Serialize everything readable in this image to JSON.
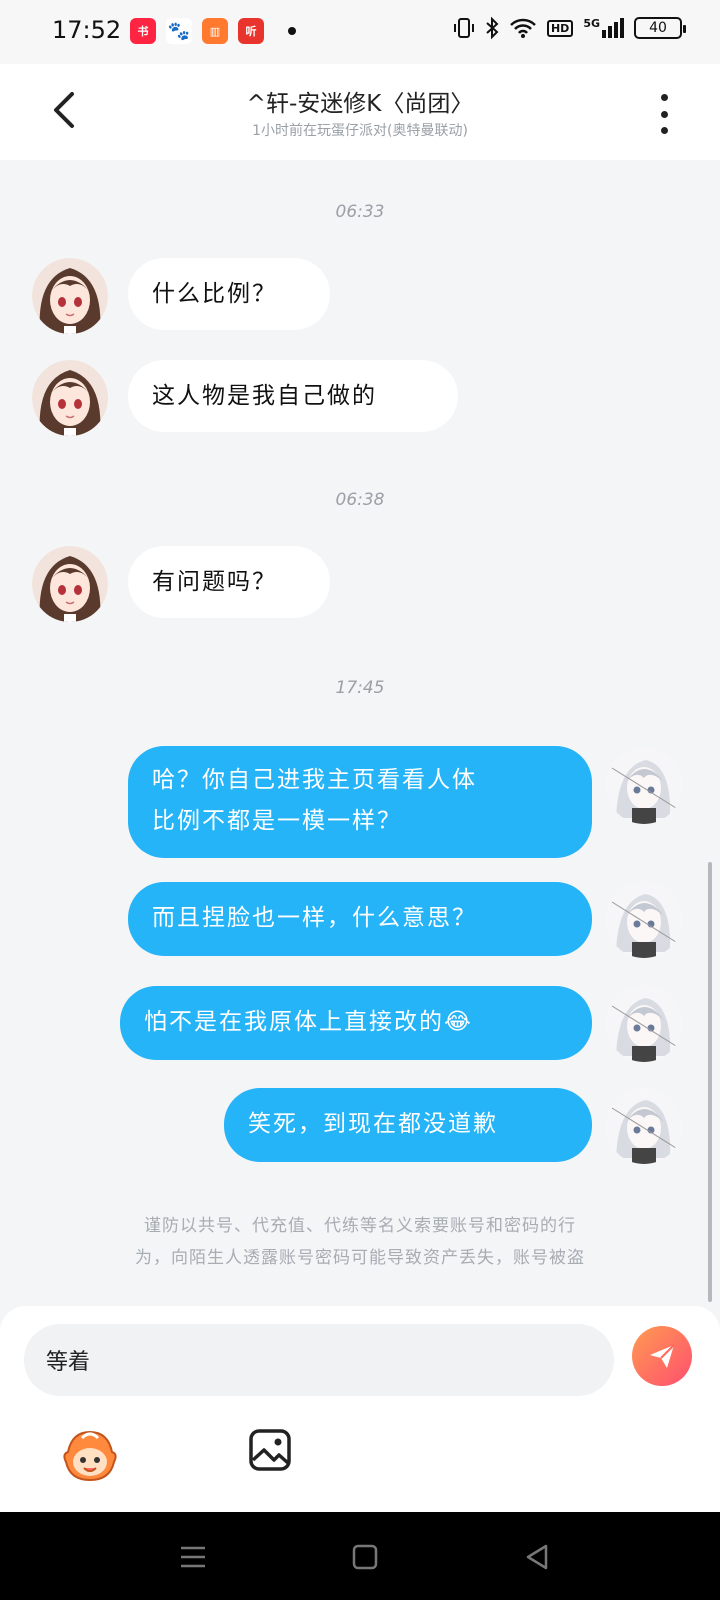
{
  "status_bar": {
    "time": "17:52",
    "battery": "40",
    "hd_label": "HD",
    "network": "5G",
    "app_icons": [
      {
        "name": "xiaohongshu-icon",
        "color": "#ff2442"
      },
      {
        "name": "baidu-icon",
        "color": "#2f6bff"
      },
      {
        "name": "books-icon",
        "color": "#ff7a2f"
      },
      {
        "name": "listen-icon",
        "color": "#e8342c"
      }
    ]
  },
  "header": {
    "title": "^轩-安迷修K〈尚团〉",
    "subtitle": "1小时前在玩蛋仔派对(奥特曼联动)"
  },
  "chat": {
    "timestamps": [
      "06:33",
      "06:38",
      "17:45"
    ],
    "messages": [
      {
        "side": "left",
        "text": "什么比例？"
      },
      {
        "side": "left",
        "text": "这人物是我自己做的"
      },
      {
        "side": "left",
        "text": "有问题吗？"
      },
      {
        "side": "right",
        "lines": [
          "哈？你自己进我主页看看人体",
          "比例不都是一模一样？"
        ]
      },
      {
        "side": "right",
        "text": "而且捏脸也一样，什么意思？"
      },
      {
        "side": "right",
        "text": "怕不是在我原体上直接改的😂"
      },
      {
        "side": "right",
        "text": "笑死，到现在都没道歉"
      }
    ],
    "notice_lines": [
      "谨防以共号、代充值、代练等名义索要账号和密码的行",
      "为，向陌生人透露账号密码可能导致资产丢失，账号被盗"
    ]
  },
  "composer": {
    "input_value": "等着"
  },
  "colors": {
    "bubble_right": "#25b4f8",
    "bubble_left": "#ffffff",
    "send_gradient_start": "#ff9b52",
    "send_gradient_end": "#ff4f6e"
  }
}
